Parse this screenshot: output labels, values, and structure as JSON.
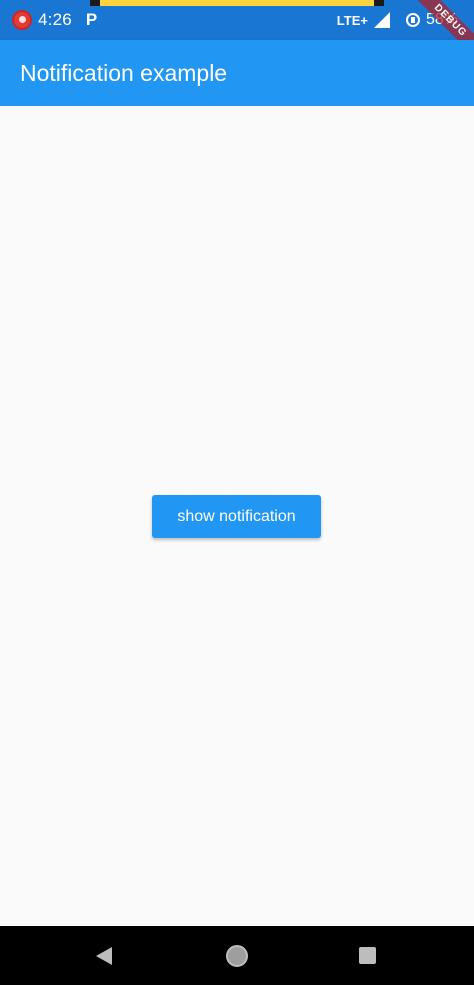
{
  "status_bar": {
    "time": "4:26",
    "p_label": "P",
    "network": "LTE+",
    "battery": "58%"
  },
  "debug_banner": {
    "label": "DEBUG"
  },
  "app_bar": {
    "title": "Notification example"
  },
  "main": {
    "button_label": "show notification"
  },
  "colors": {
    "status_bar": "#1976d2",
    "app_bar": "#2196f3",
    "button": "#2196f3",
    "background": "#fafafa",
    "nav_bar": "#000000"
  },
  "icons": {
    "status": [
      "app-notification-icon",
      "parking-icon",
      "signal-icon",
      "battery-saver-icon"
    ],
    "nav": [
      "back-icon",
      "home-icon",
      "recents-icon"
    ]
  }
}
